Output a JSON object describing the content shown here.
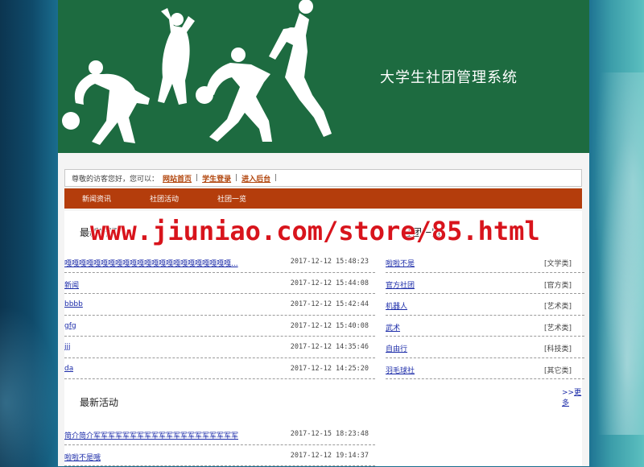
{
  "header": {
    "site_title": "大学生社团管理系统"
  },
  "topbar": {
    "greeting": "尊敬的访客您好，您可以：",
    "links": [
      {
        "label": "网站首页"
      },
      {
        "label": "学生登录"
      },
      {
        "label": "进入后台"
      }
    ],
    "separator": "|"
  },
  "nav": {
    "items": [
      {
        "label": "新闻资讯"
      },
      {
        "label": "社团活动"
      },
      {
        "label": "社团一览"
      }
    ]
  },
  "news": {
    "title": "最新新闻",
    "rows": [
      {
        "title": "嘎嘎嘎嘎嘎嘎嘎嘎嘎嘎嘎嘎嘎嘎嘎嘎嘎嘎嘎嘎嘎嘎嘎...",
        "date": "2017-12-12 15:48:23"
      },
      {
        "title": "新闻",
        "date": "2017-12-12 15:44:08"
      },
      {
        "title": "bbbb",
        "date": "2017-12-12 15:42:44"
      },
      {
        "title": "gfg",
        "date": "2017-12-12 15:40:08"
      },
      {
        "title": "jjj",
        "date": "2017-12-12 14:35:46"
      },
      {
        "title": "da",
        "date": "2017-12-12 14:25:20"
      }
    ]
  },
  "clubs": {
    "title": "社团一览",
    "rows": [
      {
        "name": "啦啦不是",
        "category": "[文学类]"
      },
      {
        "name": "官方社团",
        "category": "[官方类]"
      },
      {
        "name": "机器人",
        "category": "[艺术类]"
      },
      {
        "name": "武术",
        "category": "[艺术类]"
      },
      {
        "name": "自由行",
        "category": "[科技类]"
      },
      {
        "name": "羽毛球社",
        "category": "[其它类]"
      }
    ],
    "more_prefix": ">>",
    "more_label": "更多"
  },
  "activities": {
    "title": "最新活动",
    "rows": [
      {
        "title": "简介简介军军军军军军军军军军军军军军军军军军军军",
        "date": "2017-12-15 18:23:48"
      },
      {
        "title": "啦啦不是哦",
        "date": "2017-12-12 19:14:37"
      }
    ]
  },
  "watermark": "www.jiuniao.com/store/85.html"
}
